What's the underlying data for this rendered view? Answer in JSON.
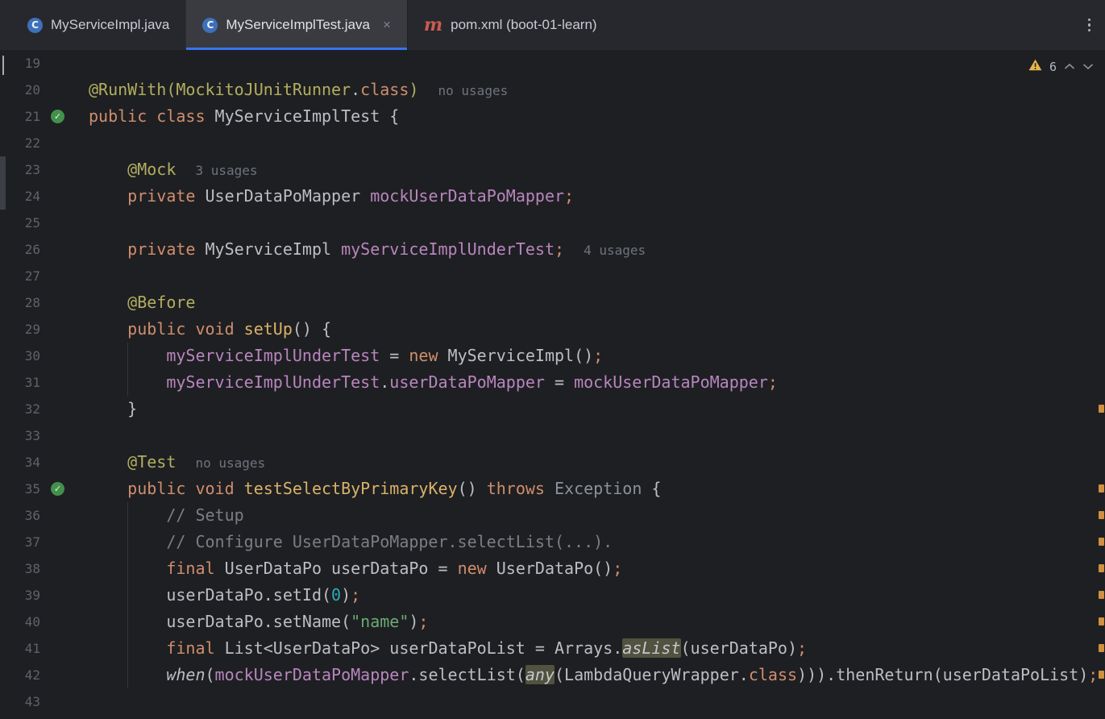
{
  "ui": {
    "close_glyph": "×"
  },
  "colors": {
    "accent_blue": "#3574f0",
    "warning_orange": "#e9b64c",
    "stripe_mark_orange": "#cf9040",
    "test_pass_green": "#43904c",
    "editor_bg": "#1e1f22",
    "tabbar_bg": "#26282d"
  },
  "tabs": [
    {
      "label": "MyServiceImpl.java",
      "icon": "java-class-icon",
      "icon_text": "C",
      "active": false,
      "closable": false
    },
    {
      "label": "MyServiceImplTest.java",
      "icon": "java-class-icon",
      "icon_text": "C",
      "active": true,
      "closable": true
    },
    {
      "label": "pom.xml (boot-01-learn)",
      "icon": "maven-icon",
      "icon_text": "m",
      "active": false,
      "closable": false
    }
  ],
  "inspection": {
    "warning_count": "6"
  },
  "editor": {
    "stripe_marks": [
      32,
      35,
      36,
      37,
      38,
      39,
      40,
      41,
      42
    ],
    "lines": [
      {
        "num": "19",
        "segments": []
      },
      {
        "num": "20",
        "segments": [
          {
            "t": "@RunWith(MockitoJUnitRunner",
            "c": "ann"
          },
          {
            "t": ".",
            "c": "def"
          },
          {
            "t": "class",
            "c": "kw"
          },
          {
            "t": ")",
            "c": "ann"
          },
          {
            "t": "  ",
            "c": "def"
          },
          {
            "t": "no usages",
            "c": "hint"
          }
        ]
      },
      {
        "num": "21",
        "gutter": "test-pass",
        "segments": [
          {
            "t": "public class ",
            "c": "kw"
          },
          {
            "t": "MyServiceImplTest {",
            "c": "def"
          }
        ]
      },
      {
        "num": "22",
        "segments": []
      },
      {
        "num": "23",
        "segments": [
          {
            "t": "    ",
            "c": "def"
          },
          {
            "t": "@Mock",
            "c": "ann"
          },
          {
            "t": "  ",
            "c": "def"
          },
          {
            "t": "3 usages",
            "c": "hint"
          }
        ]
      },
      {
        "num": "24",
        "segments": [
          {
            "t": "    ",
            "c": "def"
          },
          {
            "t": "private ",
            "c": "kw"
          },
          {
            "t": "UserDataPoMapper ",
            "c": "def"
          },
          {
            "t": "mockUserDataPoMapper",
            "c": "fld"
          },
          {
            "t": ";",
            "c": "semi"
          }
        ]
      },
      {
        "num": "25",
        "segments": []
      },
      {
        "num": "26",
        "segments": [
          {
            "t": "    ",
            "c": "def"
          },
          {
            "t": "private ",
            "c": "kw"
          },
          {
            "t": "MyServiceImpl ",
            "c": "def"
          },
          {
            "t": "myServiceImplUnderTest",
            "c": "fld"
          },
          {
            "t": ";",
            "c": "semi"
          },
          {
            "t": "  ",
            "c": "def"
          },
          {
            "t": "4 usages",
            "c": "hint"
          }
        ]
      },
      {
        "num": "27",
        "segments": []
      },
      {
        "num": "28",
        "segments": [
          {
            "t": "    ",
            "c": "def"
          },
          {
            "t": "@Before",
            "c": "ann"
          }
        ]
      },
      {
        "num": "29",
        "segments": [
          {
            "t": "    ",
            "c": "def"
          },
          {
            "t": "public void ",
            "c": "kw"
          },
          {
            "t": "setUp",
            "c": "mth"
          },
          {
            "t": "() {",
            "c": "def"
          }
        ]
      },
      {
        "num": "30",
        "segments": [
          {
            "t": "        ",
            "c": "def"
          },
          {
            "t": "myServiceImplUnderTest",
            "c": "fld"
          },
          {
            "t": " = ",
            "c": "def"
          },
          {
            "t": "new ",
            "c": "kw"
          },
          {
            "t": "MyServiceImpl()",
            "c": "def"
          },
          {
            "t": ";",
            "c": "semi"
          }
        ]
      },
      {
        "num": "31",
        "segments": [
          {
            "t": "        ",
            "c": "def"
          },
          {
            "t": "myServiceImplUnderTest",
            "c": "fld"
          },
          {
            "t": ".",
            "c": "def"
          },
          {
            "t": "userDataPoMapper",
            "c": "fld"
          },
          {
            "t": " = ",
            "c": "def"
          },
          {
            "t": "mockUserDataPoMapper",
            "c": "fld"
          },
          {
            "t": ";",
            "c": "semi"
          }
        ]
      },
      {
        "num": "32",
        "segments": [
          {
            "t": "    }",
            "c": "def"
          }
        ]
      },
      {
        "num": "33",
        "segments": []
      },
      {
        "num": "34",
        "segments": [
          {
            "t": "    ",
            "c": "def"
          },
          {
            "t": "@Test",
            "c": "ann"
          },
          {
            "t": "  ",
            "c": "def"
          },
          {
            "t": "no usages",
            "c": "hint"
          }
        ]
      },
      {
        "num": "35",
        "gutter": "test-pass",
        "segments": [
          {
            "t": "    ",
            "c": "def"
          },
          {
            "t": "public void ",
            "c": "kw"
          },
          {
            "t": "testSelectByPrimaryKey",
            "c": "mth"
          },
          {
            "t": "() ",
            "c": "def"
          },
          {
            "t": "throws ",
            "c": "kw"
          },
          {
            "t": "Exception",
            "c": "dim"
          },
          {
            "t": " {",
            "c": "def"
          }
        ]
      },
      {
        "num": "36",
        "segments": [
          {
            "t": "        ",
            "c": "def"
          },
          {
            "t": "// Setup",
            "c": "cmt"
          }
        ]
      },
      {
        "num": "37",
        "segments": [
          {
            "t": "        ",
            "c": "def"
          },
          {
            "t": "// Configure UserDataPoMapper.selectList(...).",
            "c": "cmt"
          }
        ]
      },
      {
        "num": "38",
        "segments": [
          {
            "t": "        ",
            "c": "def"
          },
          {
            "t": "final ",
            "c": "kw"
          },
          {
            "t": "UserDataPo userDataPo = ",
            "c": "def"
          },
          {
            "t": "new ",
            "c": "kw"
          },
          {
            "t": "UserDataPo()",
            "c": "def"
          },
          {
            "t": ";",
            "c": "semi"
          }
        ]
      },
      {
        "num": "39",
        "segments": [
          {
            "t": "        ",
            "c": "def"
          },
          {
            "t": "userDataPo.setId(",
            "c": "def"
          },
          {
            "t": "0",
            "c": "num"
          },
          {
            "t": ")",
            "c": "def"
          },
          {
            "t": ";",
            "c": "semi"
          }
        ]
      },
      {
        "num": "40",
        "segments": [
          {
            "t": "        ",
            "c": "def"
          },
          {
            "t": "userDataPo.setName(",
            "c": "def"
          },
          {
            "t": "\"name\"",
            "c": "str"
          },
          {
            "t": ")",
            "c": "def"
          },
          {
            "t": ";",
            "c": "semi"
          }
        ]
      },
      {
        "num": "41",
        "segments": [
          {
            "t": "        ",
            "c": "def"
          },
          {
            "t": "final ",
            "c": "kw"
          },
          {
            "t": "List<UserDataPo> userDataPoList = Arrays.",
            "c": "def"
          },
          {
            "t": "asList",
            "c": "hl"
          },
          {
            "t": "(userDataPo)",
            "c": "def"
          },
          {
            "t": ";",
            "c": "semi"
          }
        ]
      },
      {
        "num": "42",
        "segments": [
          {
            "t": "        ",
            "c": "def"
          },
          {
            "t": "when",
            "c": "it"
          },
          {
            "t": "(",
            "c": "def"
          },
          {
            "t": "mockUserDataPoMapper",
            "c": "fld"
          },
          {
            "t": ".selectList(",
            "c": "def"
          },
          {
            "t": "any",
            "c": "hl"
          },
          {
            "t": "(LambdaQueryWrapper.",
            "c": "def"
          },
          {
            "t": "class",
            "c": "kw"
          },
          {
            "t": "))).thenReturn(userDataPoList)",
            "c": "def"
          },
          {
            "t": ";",
            "c": "semi"
          }
        ]
      },
      {
        "num": "43",
        "segments": []
      }
    ]
  }
}
